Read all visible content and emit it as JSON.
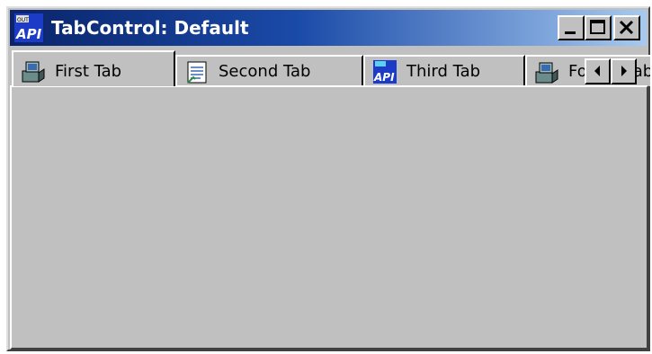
{
  "window": {
    "title": "TabControl: Default",
    "app_icon": "api-logo-icon",
    "controls": [
      "minimize",
      "maximize",
      "close"
    ]
  },
  "tabs": [
    {
      "label": "First Tab",
      "icon": "network-computer-icon",
      "selected": true
    },
    {
      "label": "Second Tab",
      "icon": "document-icon",
      "selected": false
    },
    {
      "label": "Third Tab",
      "icon": "api-logo-icon",
      "selected": false
    },
    {
      "label": "Fourth Tab",
      "icon": "network-computer-icon",
      "selected": false
    }
  ],
  "tab_scroll": [
    "scroll-left",
    "scroll-right"
  ],
  "colors": {
    "title_start": "#0a246a",
    "title_end": "#a6caf0",
    "face": "#c0c0c0"
  }
}
